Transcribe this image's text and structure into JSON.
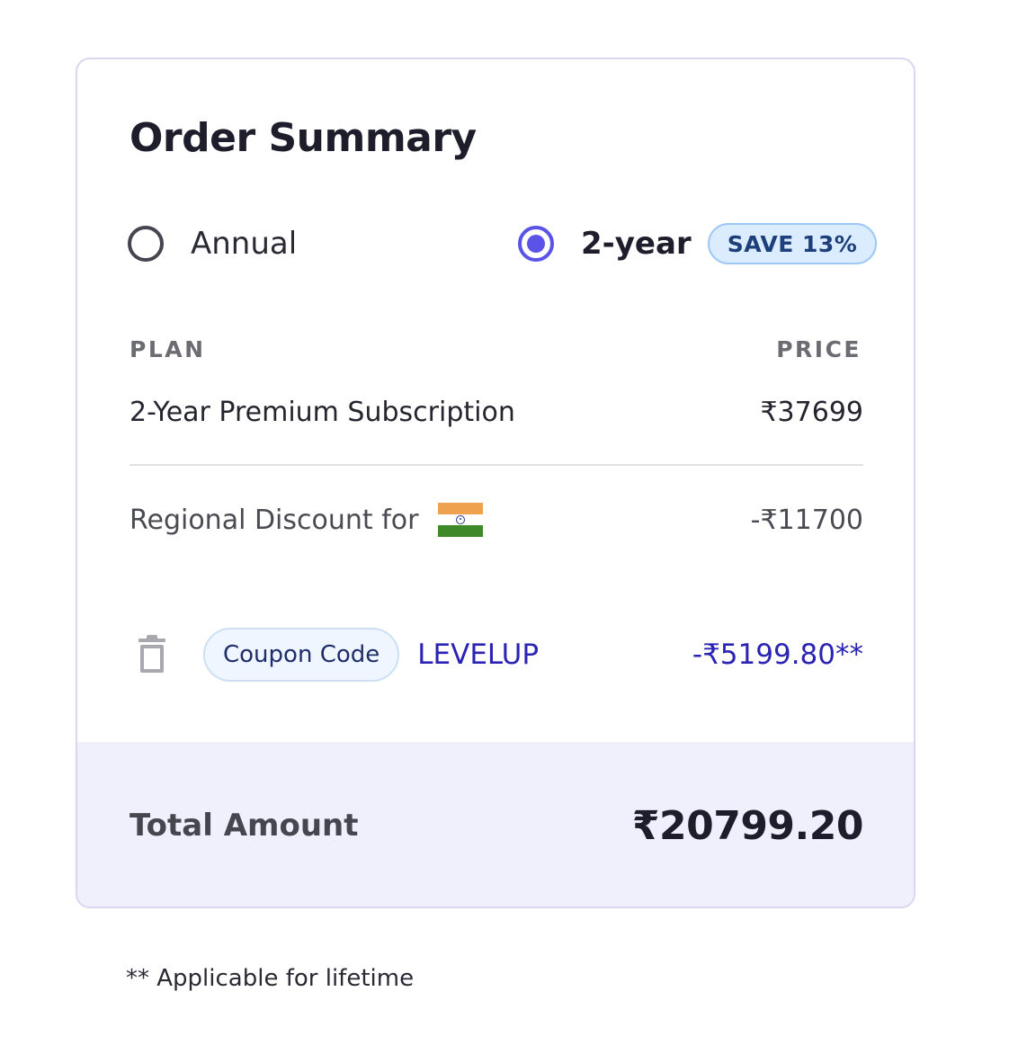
{
  "order_summary": {
    "title": "Order Summary",
    "plans": {
      "annual": {
        "label": "Annual",
        "selected": false
      },
      "two_year": {
        "label": "2-year",
        "selected": true,
        "badge": "SAVE 13%"
      }
    },
    "columns": {
      "plan": "PLAN",
      "price": "PRICE"
    },
    "line_item": {
      "name": "2-Year Premium Subscription",
      "price": "₹37699"
    },
    "regional_discount": {
      "label": "Regional Discount for",
      "flag": "india-flag-icon",
      "amount": "-₹11700"
    },
    "coupon": {
      "chip_label": "Coupon Code",
      "code": "LEVELUP",
      "amount": "-₹5199.80**",
      "remove_icon": "trash-icon"
    },
    "total": {
      "label": "Total Amount",
      "amount": "₹20799.20"
    }
  },
  "footnote": "** Applicable for lifetime",
  "colors": {
    "accent": "#5b52e8",
    "coupon_text": "#2a23b4",
    "total_band": "#f0effc",
    "badge_bg": "#dcecff"
  }
}
